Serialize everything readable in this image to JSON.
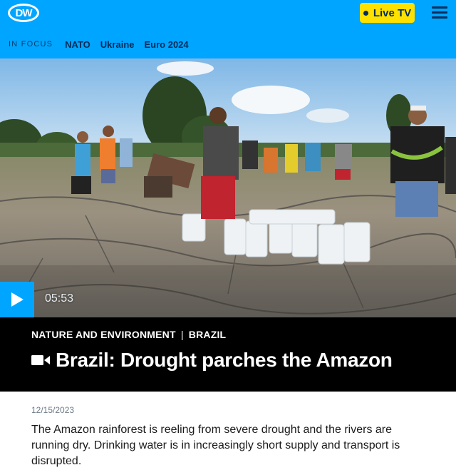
{
  "header": {
    "logo_text": "DW",
    "live_label": "Live TV",
    "menu_icon": "hamburger-menu-icon",
    "in_focus_label": "IN FOCUS",
    "focus_links": [
      "NATO",
      "Ukraine",
      "Euro 2024"
    ]
  },
  "video": {
    "duration": "05:53",
    "play_icon": "play-icon"
  },
  "article": {
    "category": "NATURE AND ENVIRONMENT",
    "region": "BRAZIL",
    "title": "Brazil: Drought parches the Amazon",
    "title_icon": "video-camera-icon",
    "date": "12/15/2023",
    "teaser": "The Amazon rainforest is reeling from severe drought and the rivers are running dry. Drinking water is in increasingly short supply and transport is disrupted."
  },
  "colors": {
    "header_bg": "#00a5ff",
    "live_bg": "#ffe100",
    "nav_text": "#002d5a",
    "title_band_bg": "#000000"
  }
}
